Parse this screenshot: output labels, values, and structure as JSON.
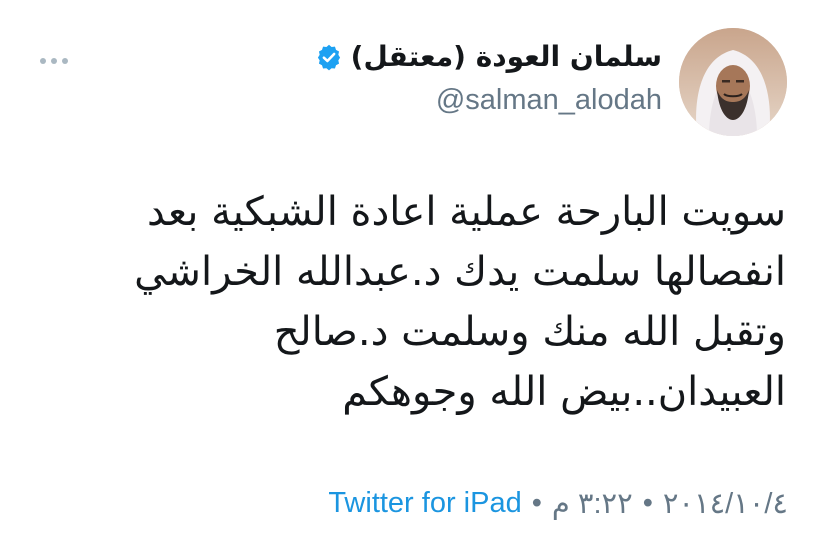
{
  "tweet": {
    "display_name": "سلمان العودة (معتقل)",
    "handle": "@salman_alodah",
    "verified_icon": "verified-badge-icon",
    "more_icon": "more-dots-icon",
    "text_lines": [
      "سويت البارحة عملية اعادة الشبكية بعد",
      "انفصالها سلمت يدك د.عبدالله الخراشي",
      "وتقبل الله منك وسلمت د.صالح",
      "العبيدان..بيض الله وجوهكم"
    ],
    "date": "٢٠١٤/١٠/٤",
    "separator": "•",
    "time": "٣:٢٢ م",
    "source": "Twitter for iPad",
    "colors": {
      "link": "#1b95e0",
      "verified": "#1da1f2",
      "muted": "#657786",
      "text": "#14171a"
    }
  }
}
